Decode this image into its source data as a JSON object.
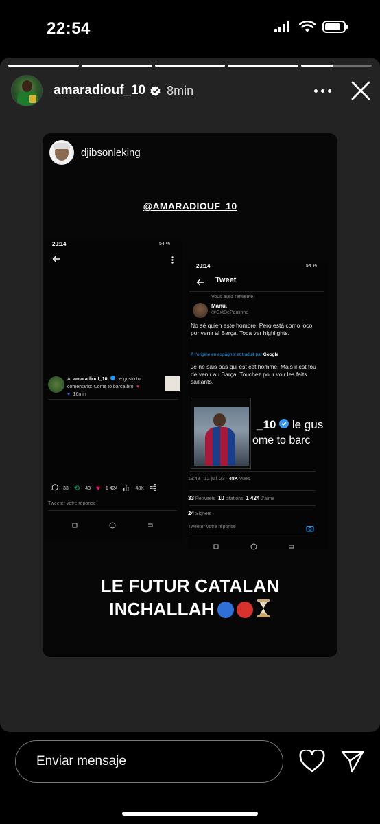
{
  "status_bar": {
    "time": "22:54"
  },
  "story": {
    "progress": [
      1,
      1,
      1,
      1,
      0.45
    ],
    "username": "amaradiouf_10",
    "time_ago": "8min",
    "card": {
      "username": "djibsonleking",
      "mention": "@AMARADIOUF_10",
      "caption_line1": "LE FUTUR CATALAN",
      "caption_line2": "INCHALLAH",
      "caption_emojis": [
        "blue-circle",
        "red-circle",
        "hourglass"
      ],
      "colors": {
        "blue": "#2f6fd6",
        "red": "#d8322c",
        "hourglass": "#c9a86a"
      }
    },
    "screen_a": {
      "time": "20:14",
      "battery": "54 %",
      "notification_user": "amaradiouf_10",
      "notification_prefix": "A",
      "notification_text": "le gustó tu comentario: Come to barca bro",
      "notification_time": "16min",
      "replies": "33",
      "retweets": "43",
      "likes": "1 424",
      "views": "48K",
      "reply_placeholder": "Tweeter votre réponse"
    },
    "screen_b": {
      "time": "20:14",
      "battery": "54 %",
      "title": "Tweet",
      "retweeted_note": "Vous avez retweeté",
      "author_name": "Manu.",
      "author_handle": "@GxtDePaulinho",
      "tweet_text": "No sé quien este hombre. Pero está como loco por venir al Barça. Toca ver highlights.",
      "translated_note": "À l'origine en espagnol et traduit par",
      "translator": "Google",
      "translation": "Je ne sais pas qui est cet homme. Mais il est fou de venir au Barça. Touchez pour voir les faits saillants.",
      "image_text_1": "_10",
      "image_text_1b": "le gus",
      "image_text_2": "ome to barc",
      "date_line": "19:48 · 12 juil. 23 ·",
      "views": "48K",
      "views_label": "Vues",
      "retweets": "33",
      "retweets_label": "Retweets",
      "citations": "10",
      "citations_label": "citations",
      "likes": "1 424",
      "likes_label": "J'aime",
      "bookmarks": "24",
      "bookmarks_label": "Signets",
      "reply_placeholder": "Tweeter votre réponse"
    }
  },
  "bottom_bar": {
    "message_placeholder": "Enviar mensaje"
  }
}
